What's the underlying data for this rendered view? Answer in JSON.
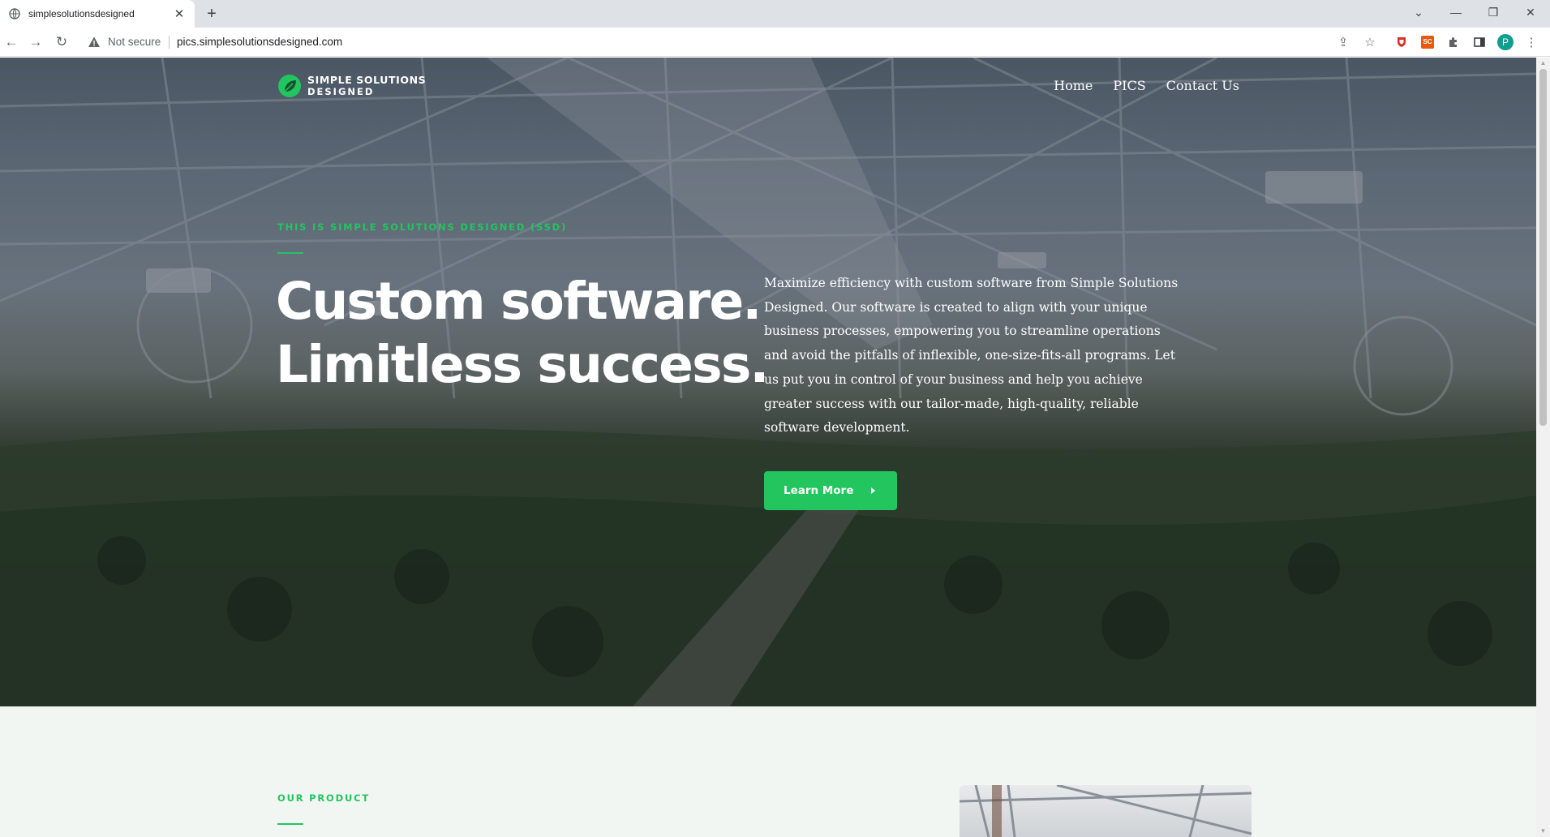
{
  "browser": {
    "tab_title": "simplesolutionsdesigned",
    "new_tab_symbol": "+",
    "security_label": "Not secure",
    "url": "pics.simplesolutionsdesigned.com",
    "profile_initial": "P",
    "extension_sc_label": "SC"
  },
  "site": {
    "logo_line1": "SIMPLE SOLUTIONS",
    "logo_line2": "DESIGNED",
    "nav": [
      "Home",
      "PICS",
      "Contact Us"
    ]
  },
  "hero": {
    "eyebrow": "THIS IS SIMPLE SOLUTIONS DESIGNED (SSD)",
    "headline_line1": "Custom software.",
    "headline_line2": "Limitless success.",
    "description": "Maximize efficiency with custom software from Simple Solutions Designed. Our software is created to align with your unique business processes, empowering you to streamline operations and avoid the pitfalls of inflexible, one-size-fits-all programs. Let us put you in control of your business and help you achieve greater success with our tailor-made, high-quality, reliable software development.",
    "cta_label": "Learn More"
  },
  "product": {
    "eyebrow": "OUR PRODUCT"
  },
  "colors": {
    "accent": "#22c55e",
    "chrome_bg": "#dee1e6",
    "section_bg": "#f2f6f3"
  }
}
